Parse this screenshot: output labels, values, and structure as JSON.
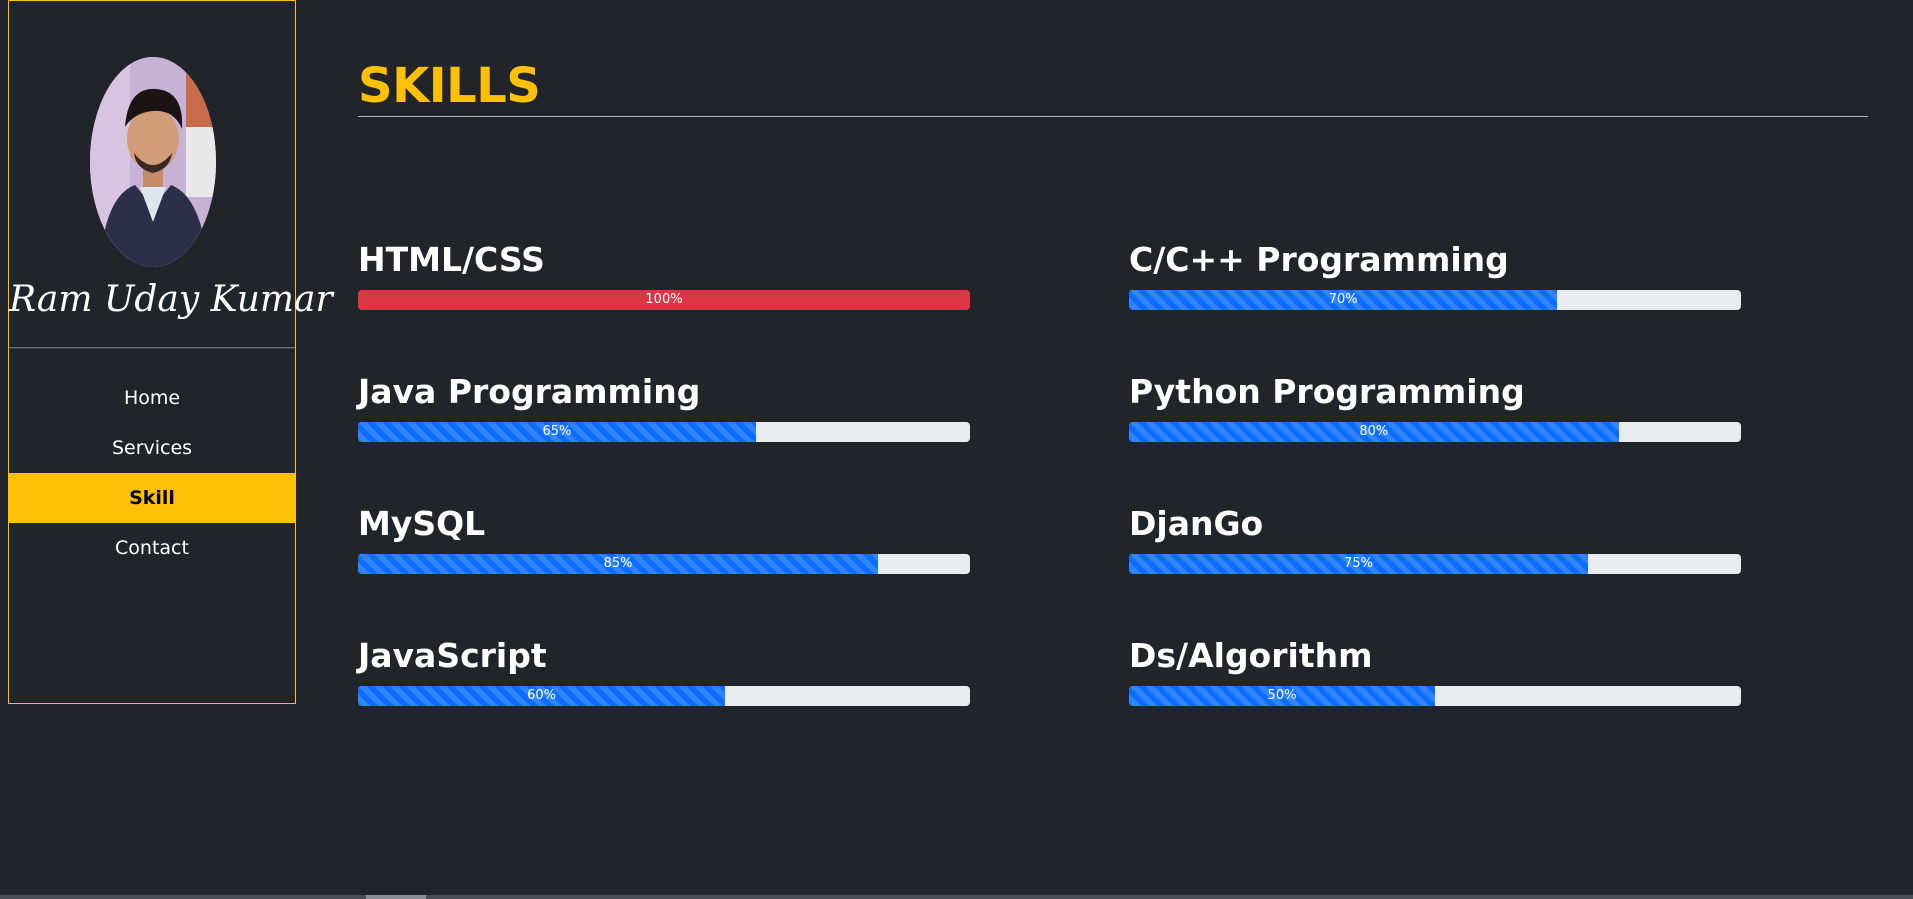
{
  "profile": {
    "name": "Ram Uday Kumar"
  },
  "nav": {
    "items": [
      {
        "label": "Home",
        "active": false
      },
      {
        "label": "Services",
        "active": false
      },
      {
        "label": "Skill",
        "active": true
      },
      {
        "label": "Contact",
        "active": false
      }
    ]
  },
  "section": {
    "title": "SKILLS"
  },
  "skills": [
    {
      "name": "HTML/CSS",
      "value": 100,
      "label": "100%",
      "color": "#dc3545",
      "style": "solid"
    },
    {
      "name": "C/C++ Programming",
      "value": 70,
      "label": "70%",
      "color": "#0d6efd",
      "style": "striped"
    },
    {
      "name": "Java Programming",
      "value": 65,
      "label": "65%",
      "color": "#0d6efd",
      "style": "striped"
    },
    {
      "name": "Python Programming",
      "value": 80,
      "label": "80%",
      "color": "#0d6efd",
      "style": "striped"
    },
    {
      "name": "MySQL",
      "value": 85,
      "label": "85%",
      "color": "#0d6efd",
      "style": "striped"
    },
    {
      "name": "DjanGo",
      "value": 75,
      "label": "75%",
      "color": "#0d6efd",
      "style": "striped"
    },
    {
      "name": "JavaScript",
      "value": 60,
      "label": "60%",
      "color": "#0d6efd",
      "style": "striped"
    },
    {
      "name": "Ds/Algorithm",
      "value": 50,
      "label": "50%",
      "color": "#0d6efd",
      "style": "striped"
    }
  ],
  "colors": {
    "accent": "#ffc107",
    "background": "#212529",
    "progress_track": "#e9ecef"
  }
}
